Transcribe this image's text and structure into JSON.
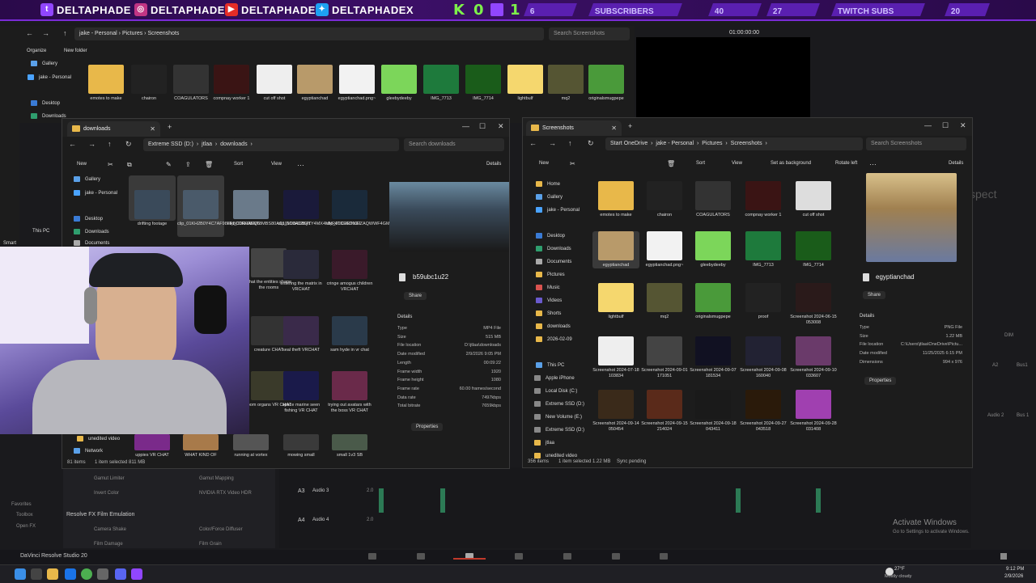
{
  "banner": {
    "handles": [
      "DELTAPHADE",
      "DELTAPHADE",
      "DELTAPHADE",
      "DELTAPHADEX"
    ],
    "kda": [
      "K",
      "0",
      "1"
    ],
    "stats": [
      {
        "value": "6",
        "label": "SUBSCRIBERS",
        "count": "40"
      },
      {
        "value": "27",
        "label": "TWITCH SUBS",
        "count": "20"
      }
    ]
  },
  "resolve": {
    "timecode": "01:00:00:00",
    "app_name": "DaVinci Resolve Studio 20",
    "panel_sections": [
      "Resolve FX Film Emulation"
    ],
    "fx_items": [
      "Gamut Limiter",
      "Gamut Mapping",
      "Invert Color",
      "NVIDIA RTX Video HDR",
      "Camera Shake",
      "Color/Force Diffuser",
      "Film Damage",
      "Film Grain"
    ],
    "left_tree": [
      "Favorites",
      "Toolbox",
      "Open FX"
    ],
    "tracks": [
      {
        "id": "A3",
        "name": "Audio 3",
        "level": "2.0"
      },
      {
        "id": "A4",
        "name": "Audio 4",
        "level": "2.0"
      }
    ],
    "mixer": {
      "dim": "DIM",
      "a2": "A2",
      "bus": "Bus1",
      "audio2": "Audio 2",
      "bus1": "Bus 1"
    },
    "watermark": {
      "title": "Activate Windows",
      "sub": "Go to Settings to activate Windows."
    },
    "bg_word": "spect"
  },
  "top_window": {
    "path": [
      "jake - Personal",
      "Pictures",
      "Screenshots"
    ],
    "search_placeholder": "Search Screenshots",
    "commands": [
      "Organize",
      "New folder"
    ],
    "sidebar": [
      "Gallery",
      "jake - Personal",
      "Desktop",
      "Downloads",
      "Documents",
      "Pictures",
      "Music",
      "Videos",
      "Shorts",
      "downloads",
      "2026-02"
    ],
    "items": [
      "emotes to make",
      "chairon",
      "COAGULATORS",
      "compnay worker 1",
      "cut off shot",
      "egyptianchad",
      "egyptianchad.png~",
      "gleebydeeby",
      "IMG_7713",
      "IMG_7714",
      "lightbulf",
      "mq2",
      "originalsmugpepe"
    ],
    "sidebar_extra": [
      "This PC",
      "Apple"
    ],
    "smart_label": "Smart"
  },
  "downloads_window": {
    "tab": "downloads",
    "path": [
      "Extreme SSD (D:)",
      "jtlaa",
      "downloads"
    ],
    "search_placeholder": "Search downloads",
    "commands": [
      "New",
      "Sort",
      "View",
      "Details"
    ],
    "sidebar": [
      "Gallery",
      "jake - Personal",
      "Desktop",
      "Downloads",
      "Documents",
      "unedited video",
      "Network"
    ],
    "items": [
      "drifting footage",
      "clip_01KH2B0Y4C7AF98FFBCDR0AEQ6",
      "clip_01KH2BNT8MBS80AC10V03ADBQY",
      "clip_01KH12B41Y4MX4NNR4TCDRTN2T",
      "clip_01KH10K0EZAQWWF4GMP1JT1SPN",
      "what the entities shape the rooms",
      "entering the matrix in VRCHAT",
      "cringe amogus children VRCHAT",
      "creature CHAT",
      "seal theft VRCHAT",
      "sam hyde in vr chat",
      "room organs VR CHAT",
      "space marine seen fishing VR CHAT",
      "trying out avatars with the boss VR CHAT",
      "uppies VR CHAT",
      "WHAT KIND OF",
      "running at vortex",
      "mowing small",
      "small 1v3 SB"
    ],
    "details": {
      "name": "b59ubc1u22",
      "share": "Share",
      "heading": "Details",
      "rows": [
        [
          "Type",
          "MP4 File"
        ],
        [
          "Size",
          "515 MB"
        ],
        [
          "File location",
          "D:\\jtlaa\\downloads"
        ],
        [
          "Date modified",
          "2/9/2026 9:05 PM"
        ],
        [
          "Length",
          "00:09:22"
        ],
        [
          "Frame width",
          "1920"
        ],
        [
          "Frame height",
          "1080"
        ],
        [
          "Frame rate",
          "60.00 frames/second"
        ],
        [
          "Data rate",
          "7497kbps"
        ],
        [
          "Total bitrate",
          "7659kbps"
        ]
      ],
      "properties": "Properties"
    },
    "status": [
      "81 items",
      "1 item selected 811 MB"
    ]
  },
  "screenshots_window": {
    "tab": "Screenshots",
    "path": [
      "Start OneDrive",
      "jake - Personal",
      "Pictures",
      "Screenshots"
    ],
    "search_placeholder": "Search Screenshots",
    "commands": [
      "New",
      "Sort",
      "View",
      "Set as background",
      "Rotate left",
      "Details"
    ],
    "sidebar": [
      "Home",
      "Gallery",
      "jake - Personal",
      "Desktop",
      "Downloads",
      "Documents",
      "Pictures",
      "Music",
      "Videos",
      "Shorts",
      "downloads",
      "2026-02-09",
      "This PC",
      "Apple iPhone",
      "Local Disk (C:)",
      "Extreme SSD (D:)",
      "New Volume (E:)",
      "Extreme SSD (D:)",
      "jtlaa",
      "unedited video"
    ],
    "items": [
      "emotes to make",
      "chairon",
      "COAGULATORS",
      "compnay worker 1",
      "cut off shot",
      "egyptianchad",
      "egyptianchad.png~",
      "gleebydeeby",
      "IMG_7713",
      "IMG_7714",
      "lightbulf",
      "mq2",
      "originalsmugpepe",
      "proof",
      "Screenshot 2024-06-15 053008",
      "Screenshot 2024-07-18 103834",
      "Screenshot 2024-09-01 171051",
      "Screenshot 2024-09-07 181534",
      "Screenshot 2024-09-08 160040",
      "Screenshot 2024-09-10 033607",
      "Screenshot 2024-09-14 050454",
      "Screenshot 2024-09-15 214024",
      "Screenshot 2024-09-18 043411",
      "Screenshot 2024-09-27 043518",
      "Screenshot 2024-09-28 031408"
    ],
    "details": {
      "name": "egyptianchad",
      "share": "Share",
      "heading": "Details",
      "rows": [
        [
          "Type",
          "PNG File"
        ],
        [
          "Size",
          "1.22 MB"
        ],
        [
          "File location",
          "C:\\Users\\jtlaa\\OneDrive\\Pictu..."
        ],
        [
          "Date modified",
          "11/25/2025 6:15 PM"
        ],
        [
          "Dimensions",
          "994 x 976"
        ]
      ],
      "properties": "Properties"
    },
    "status": [
      "356 items",
      "1 item selected 1.22 MB",
      "Sync pending"
    ]
  },
  "taskbar": {
    "weather_temp": "27°F",
    "weather_desc": "Mostly cloudy",
    "time": "9:12 PM",
    "date": "2/9/2026"
  },
  "colors": {
    "accent": "#5a1fb0",
    "folder": "#e8b84a",
    "selection": "#3a3a3a"
  }
}
